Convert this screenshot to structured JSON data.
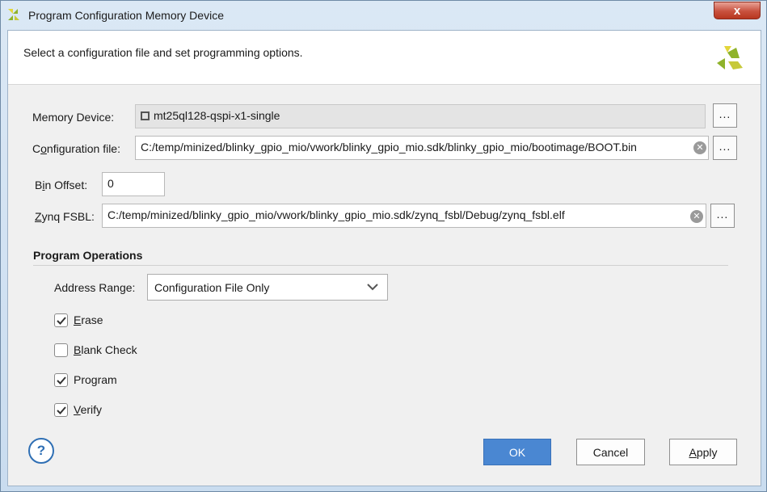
{
  "window": {
    "title": "Program Configuration Memory Device",
    "close_label": "x"
  },
  "header": {
    "instruction": "Select a configuration file and set programming options."
  },
  "form": {
    "memory_device": {
      "label": "Memory Device:",
      "value": "mt25ql128-qspi-x1-single"
    },
    "configuration_file": {
      "label_pre": "C",
      "label_mid": "o",
      "label_post": "nfiguration file:",
      "value": "C:/temp/minized/blinky_gpio_mio/vwork/blinky_gpio_mio.sdk/blinky_gpio_mio/bootimage/BOOT.bin"
    },
    "bin_offset": {
      "label_pre": "B",
      "label_mid": "i",
      "label_post": "n Offset:",
      "value": "0"
    },
    "zynq_fsbl": {
      "label_pre": "",
      "label_mid": "Z",
      "label_post": "ynq FSBL:",
      "value": "C:/temp/minized/blinky_gpio_mio/vwork/blinky_gpio_mio.sdk/zynq_fsbl/Debug/zynq_fsbl.elf"
    },
    "browse_label": "..."
  },
  "program_operations": {
    "title": "Program Operations",
    "address_range": {
      "label_pre": "Address Ran",
      "label_mid": "g",
      "label_post": "e:",
      "selected": "Configuration File Only"
    },
    "options": [
      {
        "mnemonic": "E",
        "rest": "rase",
        "checked": true
      },
      {
        "mnemonic": "B",
        "rest": "lank Check",
        "checked": false
      },
      {
        "mnemonic": "",
        "rest": "Program",
        "checked": true
      },
      {
        "mnemonic": "V",
        "rest": "erify",
        "checked": true
      }
    ]
  },
  "buttons": {
    "help": "?",
    "ok": "OK",
    "cancel": "Cancel",
    "apply_mnemonic": "A",
    "apply_rest": "pply"
  },
  "colors": {
    "primary_button": "#4a87d2",
    "logo_green": "#8fb32a",
    "logo_yellow": "#e3d63a"
  }
}
